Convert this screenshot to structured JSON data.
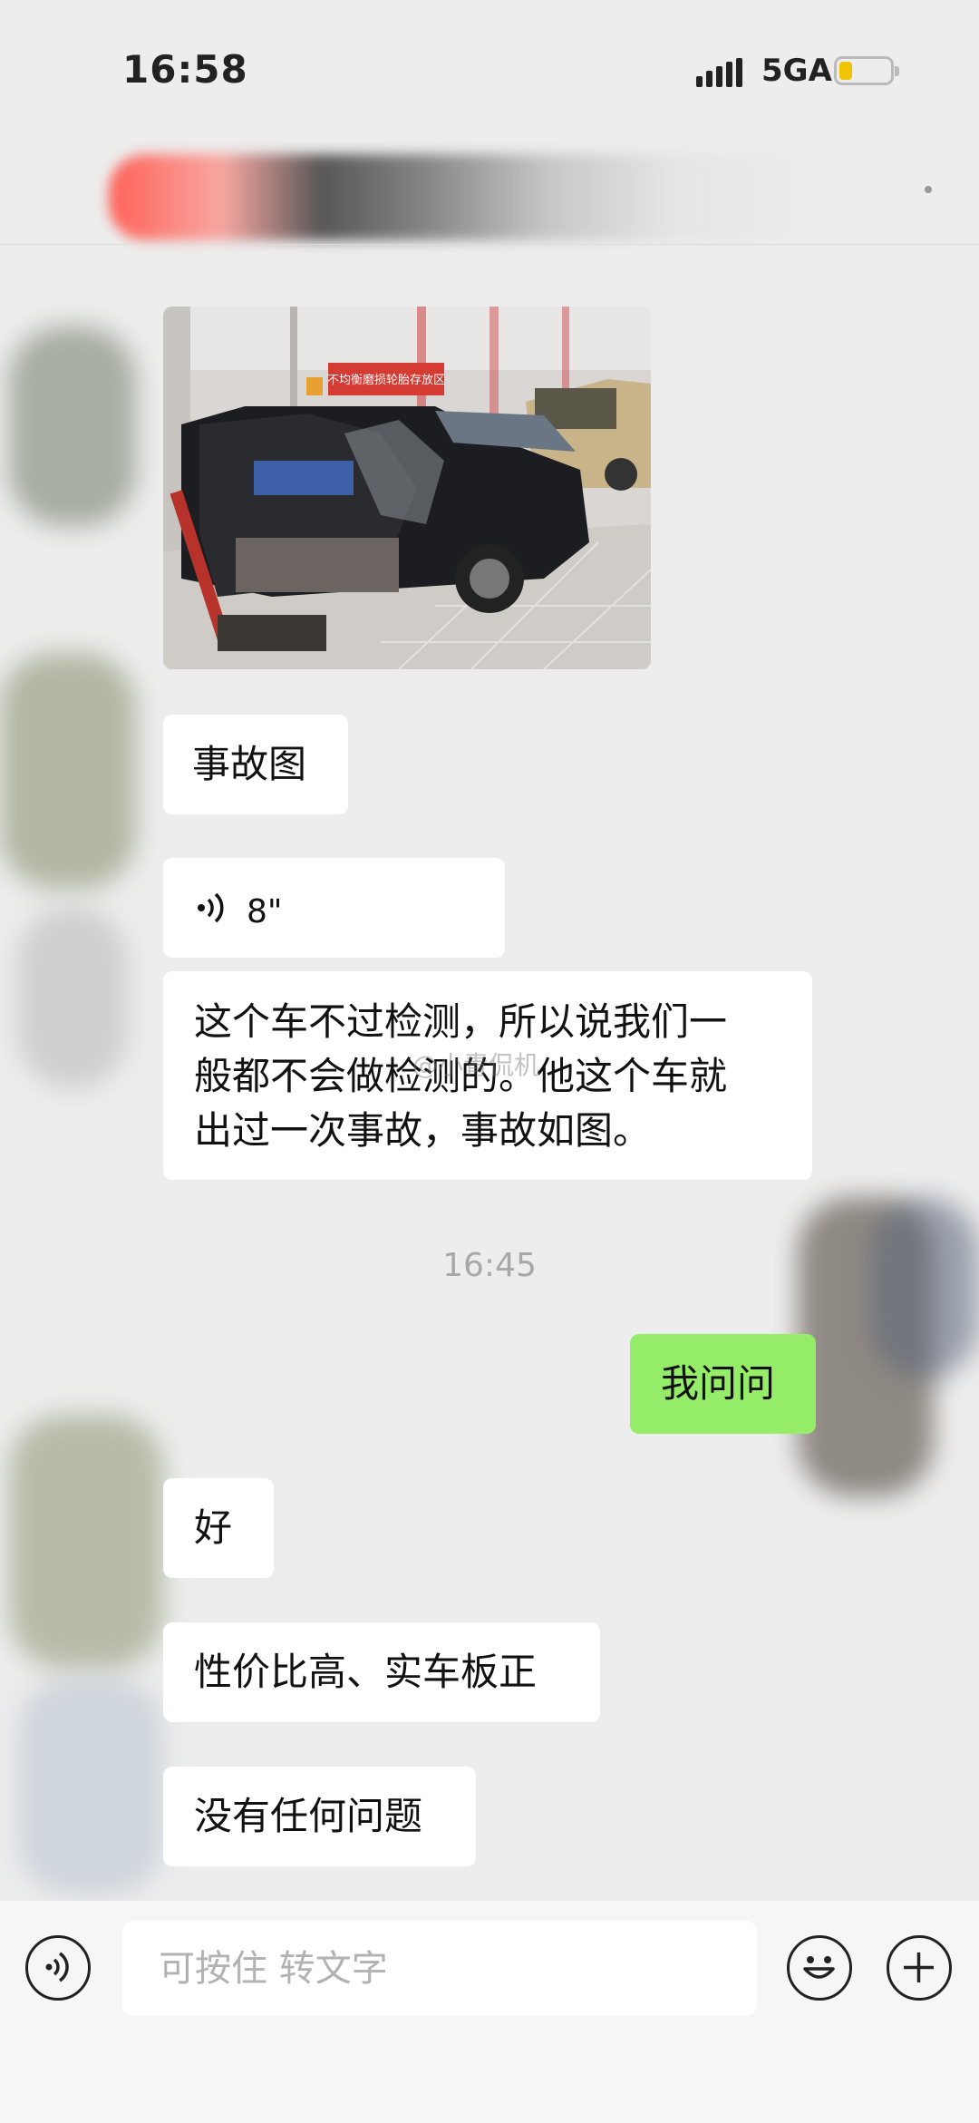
{
  "status_bar": {
    "time": "16:58",
    "network": "5GA"
  },
  "chat_image": {
    "caption": "不均衡磨损轮胎存放区"
  },
  "messages": {
    "m1": "事故图",
    "voice": {
      "duration": "8\""
    },
    "m2_lines": [
      "这个车不过检测，所以说我们一",
      "般都不会做检测的。他这个车就",
      "出过一次事故，事故如图。"
    ],
    "timestamp": "16:45",
    "m3_self": "我问问",
    "m4": "好",
    "m5": "性价比高、实车板正",
    "m6": "没有任何问题"
  },
  "watermark": "@小青侃机",
  "input": {
    "placeholder": "可按住 转文字"
  },
  "icons": [
    "voice-icon",
    "emoji-icon",
    "plus-icon"
  ],
  "colors": {
    "self_bubble": "#95ec69",
    "background": "#ededed",
    "other_bubble": "#ffffff"
  }
}
